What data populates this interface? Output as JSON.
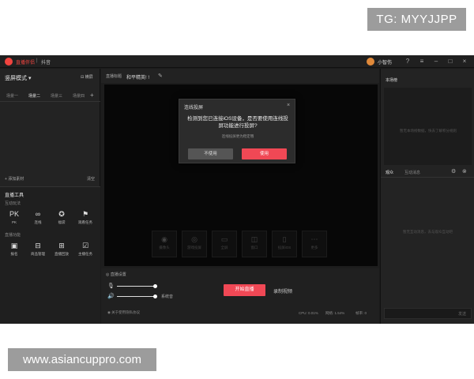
{
  "watermarks": {
    "top": "TG: MYYJJPP",
    "bottom": "www.asiancuppro.com"
  },
  "titlebar": {
    "app_name": "直播伴侣",
    "separator": "|",
    "platform": "抖音",
    "user_name": "小智伤",
    "icons": [
      "help-icon",
      "menu-icon",
      "minimize-icon",
      "maximize-icon",
      "close-icon"
    ]
  },
  "left_panel": {
    "scene_mode": "竖屏模式 ▾",
    "scene_button": "横屏",
    "scene_tabs": [
      "场景一",
      "场景二",
      "场景三",
      "场景四"
    ],
    "active_tab": 1,
    "add_material": "+ 添加素材",
    "clear": "清空",
    "tools_title": "直播工具",
    "group_interact": "互动玩法",
    "group_live": "直播功能",
    "tools_row1": [
      {
        "icon": "pk-icon",
        "glyph": "PK",
        "label": "PK"
      },
      {
        "icon": "link-icon",
        "glyph": "∞",
        "label": "连线"
      },
      {
        "icon": "gift-icon",
        "glyph": "✪",
        "label": "福袋"
      },
      {
        "icon": "task-icon",
        "glyph": "⚑",
        "label": "观看任务"
      }
    ],
    "tools_row2": [
      {
        "icon": "ranking-icon",
        "glyph": "▣",
        "label": "报名"
      },
      {
        "icon": "shop-icon",
        "glyph": "⊟",
        "label": "商品管理"
      },
      {
        "icon": "replay-icon",
        "glyph": "⊞",
        "label": "直播回放"
      },
      {
        "icon": "anchor-task-icon",
        "glyph": "☑",
        "label": "主播任务"
      }
    ]
  },
  "center": {
    "live_label": "直播标题",
    "live_title": "和平精英! !",
    "sources": [
      {
        "icon": "camera-icon",
        "glyph": "◉",
        "label": "摄像头"
      },
      {
        "icon": "game-icon",
        "glyph": "◎",
        "label": "游戏投屏"
      },
      {
        "icon": "fullscreen-icon",
        "glyph": "▭",
        "label": "全屏"
      },
      {
        "icon": "window-icon",
        "glyph": "◫",
        "label": "窗口"
      },
      {
        "icon": "phone-icon",
        "glyph": "▯",
        "label": "投屏iOS"
      },
      {
        "icon": "more-icon",
        "glyph": "⋯",
        "label": "更多"
      }
    ],
    "dialog": {
      "title": "连线投屏",
      "message": "检测到您已连接iOS设备，是否要使用连线投屏功能进行投屏?",
      "hint": "连线投屏更为稳定哦",
      "no": "不使用",
      "yes": "使用"
    },
    "bottom": {
      "beauty": "◎ 直播设置",
      "system_sound": "系统音",
      "start": "开始直播",
      "record": "录制视频",
      "privacy": "◉ 关于使用隐私协议",
      "cpu": "CPU: 0.01%",
      "net": "网络: 1.54%",
      "fps": "帧率: 0"
    }
  },
  "right_panel": {
    "top_title": "本场榜",
    "top_empty": "暂无本场榜数据，快去了解积分规则",
    "tab_audience": "观众",
    "tab_chat": "互动消息",
    "chat_empty": "暂无互动消息，去与观众互动吧",
    "send": "发送"
  }
}
